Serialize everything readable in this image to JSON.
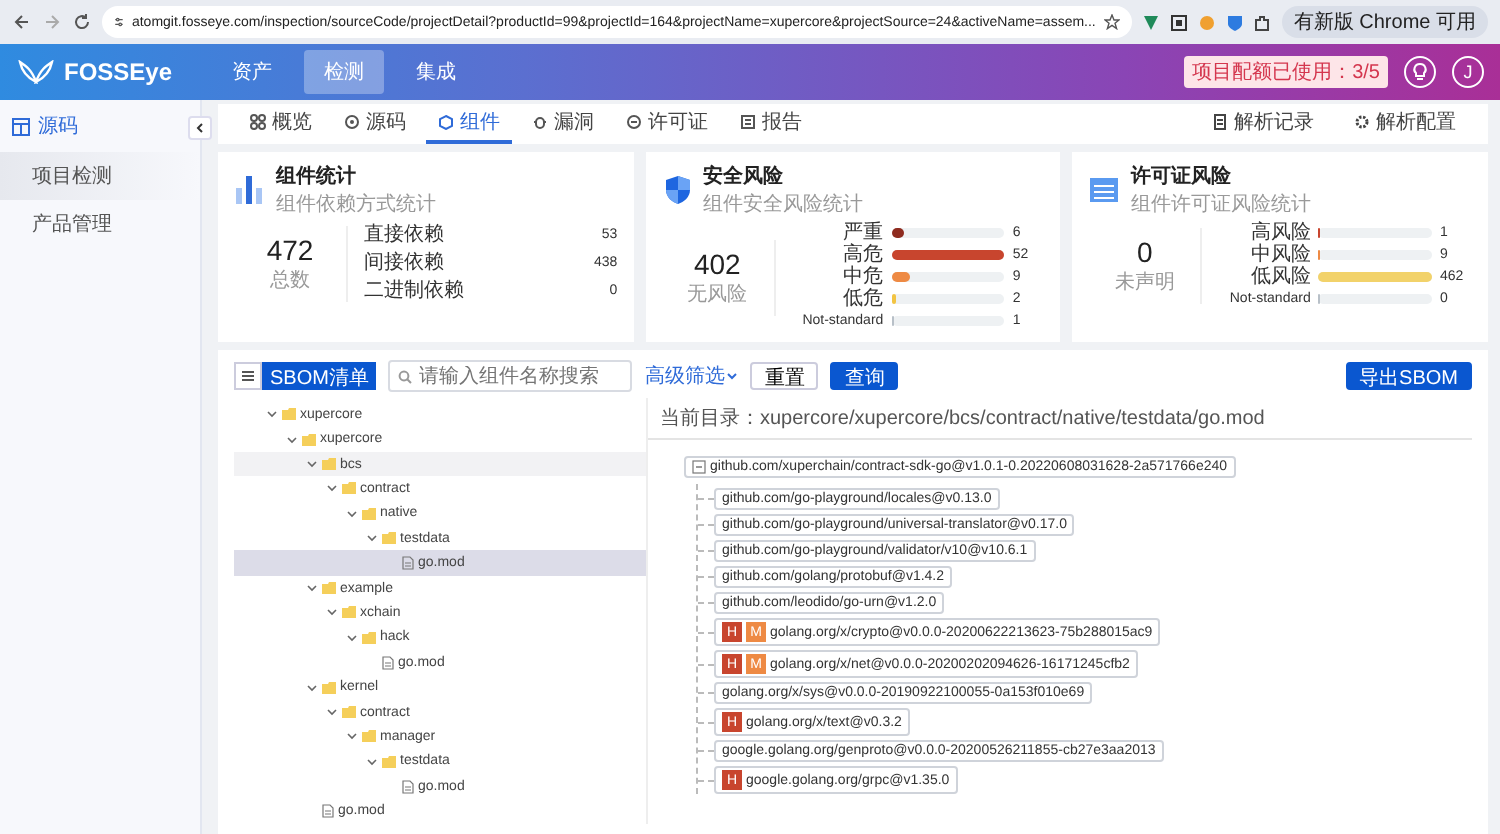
{
  "browser": {
    "url": "atomgit.fosseye.com/inspection/sourceCode/projectDetail?productId=99&projectId=164&projectName=xupercore&projectSource=24&activeName=assem...",
    "update_button": "有新版 Chrome 可用"
  },
  "header": {
    "logo": "FOSSEye",
    "nav": [
      {
        "label": "资产",
        "selected": false
      },
      {
        "label": "检测",
        "selected": true
      },
      {
        "label": "集成",
        "selected": false
      }
    ],
    "quota": "项目配额已使用：3/5",
    "avatar": "J"
  },
  "sidebar": {
    "section": "源码",
    "items": [
      {
        "label": "项目检测",
        "selected": true
      },
      {
        "label": "产品管理",
        "selected": false
      }
    ]
  },
  "subtabs": [
    {
      "label": "概览",
      "kind": "overview",
      "selected": false
    },
    {
      "label": "源码",
      "kind": "source",
      "selected": false
    },
    {
      "label": "组件",
      "kind": "component",
      "selected": true
    },
    {
      "label": "漏洞",
      "kind": "vuln",
      "selected": false
    },
    {
      "label": "许可证",
      "kind": "license",
      "selected": false
    },
    {
      "label": "报告",
      "kind": "report",
      "selected": false
    }
  ],
  "subtab_actions": [
    {
      "label": "解析记录",
      "kind": "record"
    },
    {
      "label": "解析配置",
      "kind": "config"
    }
  ],
  "cards": [
    {
      "kind": "dependency",
      "title": "组件统计",
      "subtitle": "组件依赖方式统计",
      "total": "472",
      "total_label": "总数",
      "rows": [
        {
          "label": "直接依赖",
          "value": "53"
        },
        {
          "label": "间接依赖",
          "value": "438"
        },
        {
          "label": "二进制依赖",
          "value": "0"
        }
      ]
    },
    {
      "kind": "security",
      "title": "安全风险",
      "subtitle": "组件安全风险统计",
      "total": "402",
      "total_label": "无风险",
      "rows": [
        {
          "label": "严重",
          "value": "6",
          "level": 0.12,
          "color": "#8e2b1f"
        },
        {
          "label": "高危",
          "value": "52",
          "level": 1,
          "color": "#c8452e"
        },
        {
          "label": "中危",
          "value": "9",
          "level": 0.17,
          "color": "#ee8a44"
        },
        {
          "label": "低危",
          "value": "2",
          "level": 0.04,
          "color": "#f2c443"
        },
        {
          "label": "Not-standard",
          "value": "1",
          "level": 0.02,
          "color": "#b8c0c8"
        }
      ]
    },
    {
      "kind": "license",
      "title": "许可证风险",
      "subtitle": "组件许可证风险统计",
      "total": "0",
      "total_label": "未声明",
      "rows": [
        {
          "label": "高风险",
          "value": "1",
          "level": 0.005,
          "color": "#c8452e"
        },
        {
          "label": "中风险",
          "value": "9",
          "level": 0.02,
          "color": "#ee8a44"
        },
        {
          "label": "低风险",
          "value": "462",
          "level": 1,
          "color": "#f2d26a"
        },
        {
          "label": "Not-standard",
          "value": "0",
          "level": 0,
          "color": "#b8c0c8"
        }
      ]
    }
  ],
  "toolbar": {
    "list_toggle_selected": false,
    "sbom_button": {
      "label": "SBOM清单",
      "selected": true
    },
    "search_placeholder": "请输入组件名称搜索",
    "filter": "高级筛选",
    "reset": "重置",
    "query": "查询",
    "export": "导出SBOM"
  },
  "path": "当前目录：xupercore/xupercore/bcs/contract/native/testdata/go.mod",
  "tree": [
    {
      "label": "xupercore",
      "kind": "folder",
      "expanded": true,
      "selected": false,
      "highlighted": false,
      "children": [
        {
          "label": "xupercore",
          "kind": "folder",
          "expanded": true,
          "selected": false,
          "highlighted": false,
          "children": [
            {
              "label": "bcs",
              "kind": "folder",
              "expanded": true,
              "selected": false,
              "highlighted": true,
              "children": [
                {
                  "label": "contract",
                  "kind": "folder",
                  "expanded": true,
                  "selected": false,
                  "highlighted": false,
                  "children": [
                    {
                      "label": "native",
                      "kind": "folder",
                      "expanded": true,
                      "selected": false,
                      "highlighted": false,
                      "children": [
                        {
                          "label": "testdata",
                          "kind": "folder",
                          "expanded": true,
                          "selected": false,
                          "highlighted": false,
                          "children": [
                            {
                              "label": "go.mod",
                              "kind": "file",
                              "selected": true,
                              "highlighted": false
                            }
                          ]
                        }
                      ]
                    }
                  ]
                }
              ]
            },
            {
              "label": "example",
              "kind": "folder",
              "expanded": true,
              "selected": false,
              "highlighted": false,
              "children": [
                {
                  "label": "xchain",
                  "kind": "folder",
                  "expanded": true,
                  "selected": false,
                  "highlighted": false,
                  "children": [
                    {
                      "label": "hack",
                      "kind": "folder",
                      "expanded": true,
                      "selected": false,
                      "highlighted": false,
                      "children": [
                        {
                          "label": "go.mod",
                          "kind": "file",
                          "selected": false,
                          "highlighted": false
                        }
                      ]
                    }
                  ]
                }
              ]
            },
            {
              "label": "kernel",
              "kind": "folder",
              "expanded": true,
              "selected": false,
              "highlighted": false,
              "children": [
                {
                  "label": "contract",
                  "kind": "folder",
                  "expanded": true,
                  "selected": false,
                  "highlighted": false,
                  "children": [
                    {
                      "label": "manager",
                      "kind": "folder",
                      "expanded": true,
                      "selected": false,
                      "highlighted": false,
                      "children": [
                        {
                          "label": "testdata",
                          "kind": "folder",
                          "expanded": true,
                          "selected": false,
                          "highlighted": false,
                          "children": [
                            {
                              "label": "go.mod",
                              "kind": "file",
                              "selected": false,
                              "highlighted": false
                            }
                          ]
                        }
                      ]
                    }
                  ]
                }
              ]
            },
            {
              "label": "go.mod",
              "kind": "file",
              "selected": false,
              "highlighted": false
            }
          ]
        }
      ]
    }
  ],
  "dependencies": {
    "root": {
      "label": "github.com/xuperchain/contract-sdk-go@v1.0.1-0.20220608031628-2a571766e240",
      "expanded": true
    },
    "children": [
      {
        "label": "github.com/go-playground/locales@v0.13.0"
      },
      {
        "label": "github.com/go-playground/universal-translator@v0.17.0"
      },
      {
        "label": "github.com/go-playground/validator/v10@v10.6.1"
      },
      {
        "label": "github.com/golang/protobuf@v1.4.2"
      },
      {
        "label": "github.com/leodido/go-urn@v1.2.0"
      },
      {
        "label": "golang.org/x/crypto@v0.0.0-20200622213623-75b288015ac9",
        "badges": [
          {
            "label": "H",
            "color": "#c8452e"
          },
          {
            "label": "M",
            "color": "#ee8a44"
          }
        ]
      },
      {
        "label": "golang.org/x/net@v0.0.0-20200202094626-16171245cfb2",
        "badges": [
          {
            "label": "H",
            "color": "#c8452e"
          },
          {
            "label": "M",
            "color": "#ee8a44"
          }
        ]
      },
      {
        "label": "golang.org/x/sys@v0.0.0-20190922100055-0a153f010e69"
      },
      {
        "label": "golang.org/x/text@v0.3.2",
        "badges": [
          {
            "label": "H",
            "color": "#c8452e"
          }
        ]
      },
      {
        "label": "google.golang.org/genproto@v0.0.0-20200526211855-cb27e3aa2013"
      },
      {
        "label": "google.golang.org/grpc@v1.35.0",
        "badges": [
          {
            "label": "H",
            "color": "#c8452e"
          }
        ]
      }
    ]
  }
}
